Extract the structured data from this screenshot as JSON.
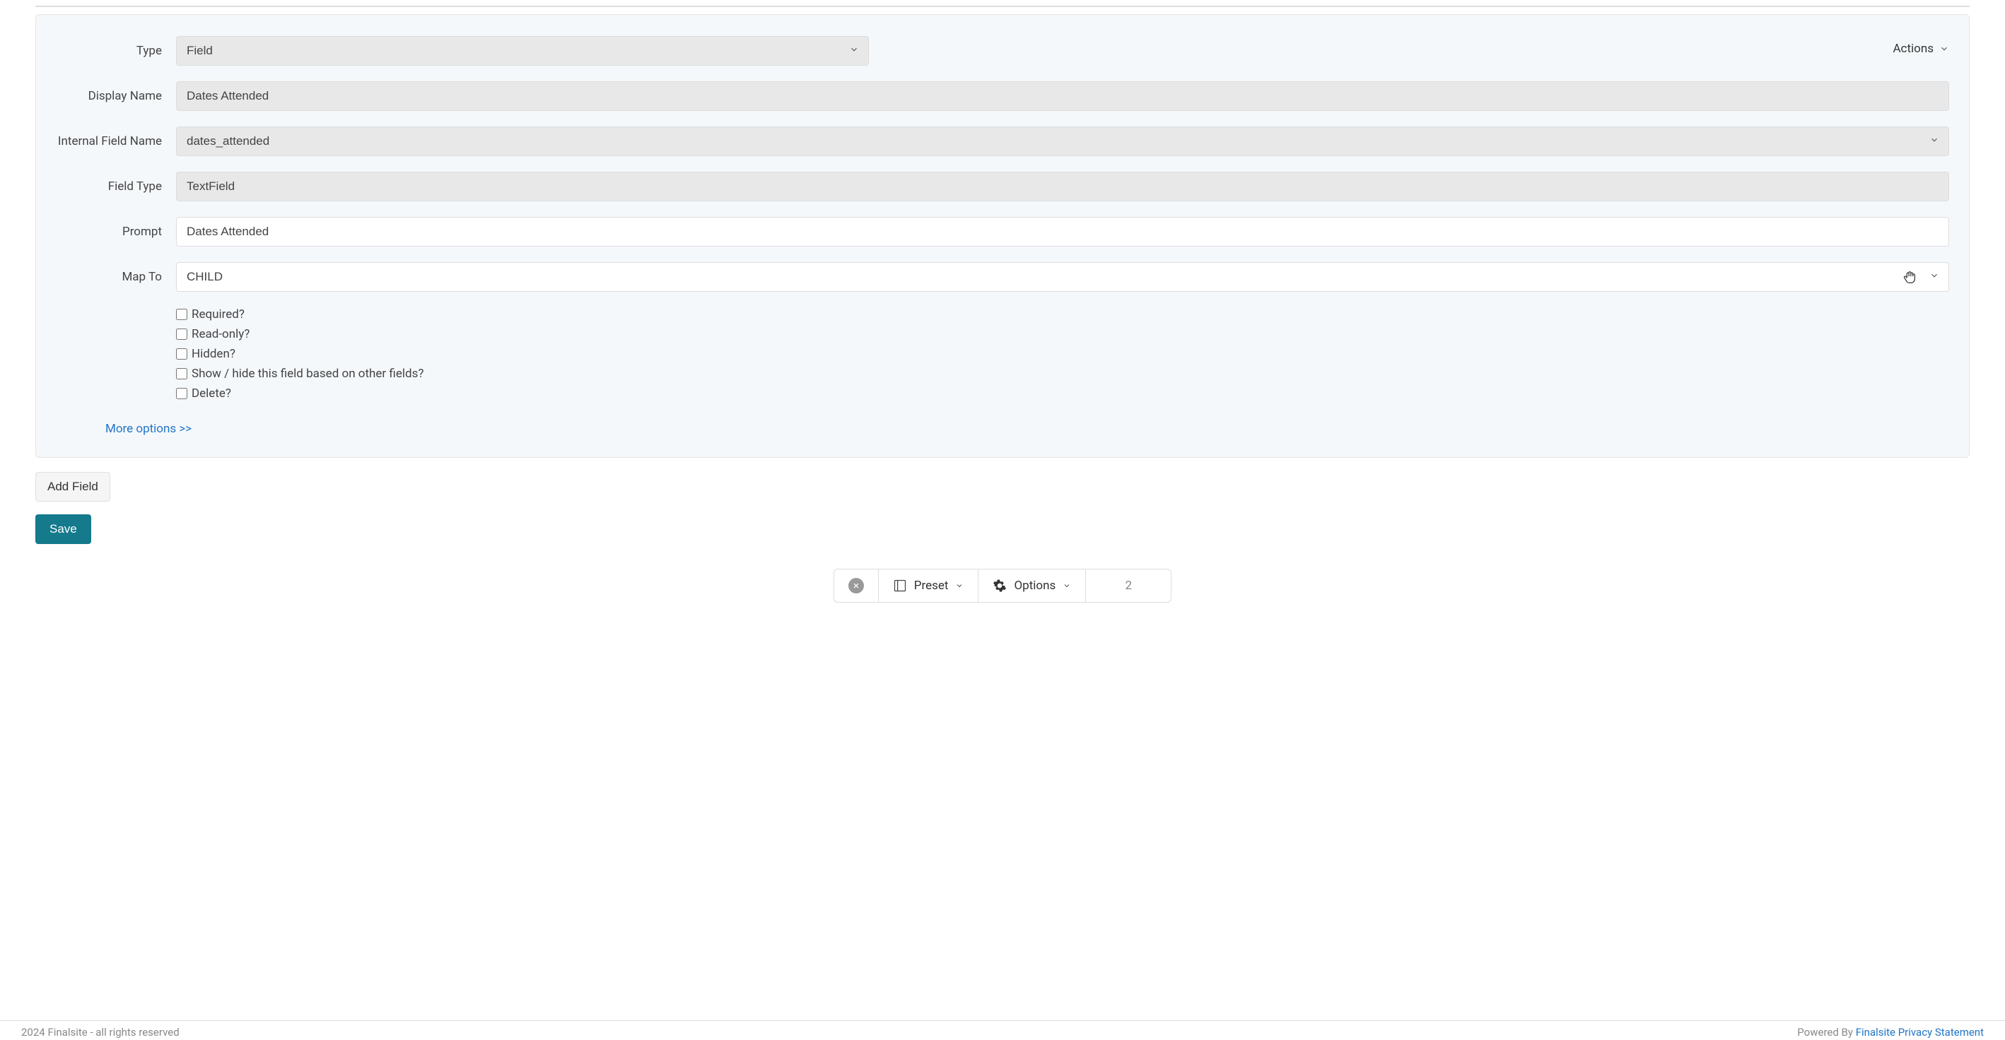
{
  "form": {
    "type_label": "Type",
    "type_value": "Field",
    "display_name_label": "Display Name",
    "display_name_value": "Dates Attended",
    "internal_name_label": "Internal Field Name",
    "internal_name_value": "dates_attended",
    "field_type_label": "Field Type",
    "field_type_value": "TextField",
    "prompt_label": "Prompt",
    "prompt_value": "Dates Attended",
    "map_to_label": "Map To",
    "map_to_value": "CHILD",
    "checkboxes": {
      "required": "Required?",
      "readonly": "Read-only?",
      "hidden": "Hidden?",
      "showhide": "Show / hide this field based on other fields?",
      "delete": "Delete?"
    },
    "more_options": "More options >>",
    "actions_label": "Actions"
  },
  "buttons": {
    "add_field": "Add Field",
    "save": "Save"
  },
  "toolbar": {
    "preset_label": "Preset",
    "options_label": "Options",
    "page_number": "2"
  },
  "footer": {
    "copyright": "2024 Finalsite - all rights reserved",
    "powered_by": "Powered By ",
    "privacy_link": "Finalsite Privacy Statement"
  }
}
